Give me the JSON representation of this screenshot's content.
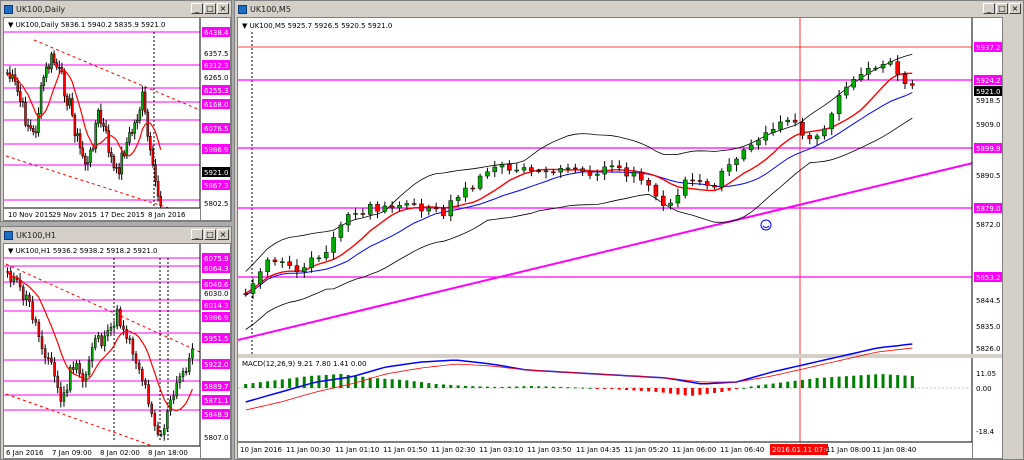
{
  "windows": {
    "daily": {
      "title": "UK100,Daily",
      "header": "UK100,Daily  5836.1 5940.2 5835.9 5921.0",
      "price_labels": [
        "6438.4",
        "6357.5",
        "6312.3",
        "6265.0",
        "6255.3",
        "6168.0",
        "6076.5",
        "5986.9",
        "5921.0",
        "5867.3",
        "5802.5"
      ],
      "time_labels": [
        "10 Nov 2015",
        "29 Nov 2015",
        "17 Dec 2015",
        "8 Jan 2016"
      ]
    },
    "h1": {
      "title": "UK100,H1",
      "header": "UK100,H1  5936.2 5938.2 5918.2 5921.0",
      "price_labels": [
        "6075.9",
        "6064.3",
        "6040.6",
        "6030.0",
        "6014.3",
        "5986.9",
        "5951.5",
        "5922.0",
        "5889.7",
        "5871.1",
        "5848.9",
        "5807.0"
      ],
      "time_labels": [
        "6 Jan 2016",
        "7 Jan 09:00",
        "8 Jan 02:00",
        "8 Jan 18:00"
      ]
    },
    "m5": {
      "title": "UK100,M5",
      "header": "UK100,M5  5925.7 5926.5 5920.5 5921.0",
      "price_labels": [
        "5937.2",
        "5924.2",
        "5921.0",
        "5918.5",
        "5909.0",
        "5899.9",
        "5890.5",
        "5879.0",
        "5872.0",
        "5853.2",
        "5844.5",
        "5835.0",
        "5826.0"
      ],
      "time_labels": [
        "10 Jan 2016",
        "11 Jan 00:30",
        "11 Jan 01:10",
        "11 Jan 01:50",
        "11 Jan 02:30",
        "11 Jan 03:10",
        "11 Jan 03:50",
        "11 Jan 04:35",
        "11 Jan 05:20",
        "11 Jan 06:00",
        "11 Jan 06:40",
        "2016.01.11 07:45",
        "11 Jan 08:00",
        "11 Jan 08:40"
      ],
      "macd_header": "MACD(12,26,9) 9.21 7.80 1.41 0.00",
      "macd_labels": [
        "11.05",
        "0.00",
        "-18.4"
      ]
    }
  },
  "colors": {
    "level_line": "#ff00ff",
    "price_tag": "#ff00ff",
    "current_tag": "#000000",
    "bull": "#00aa00",
    "bear": "#ff0000",
    "ma_red": "#ff0000",
    "ma_blue": "#0000ff"
  },
  "icons": [
    "chart-window-icon",
    "minimize-icon",
    "maximize-icon",
    "close-icon",
    "smiley-icon"
  ]
}
